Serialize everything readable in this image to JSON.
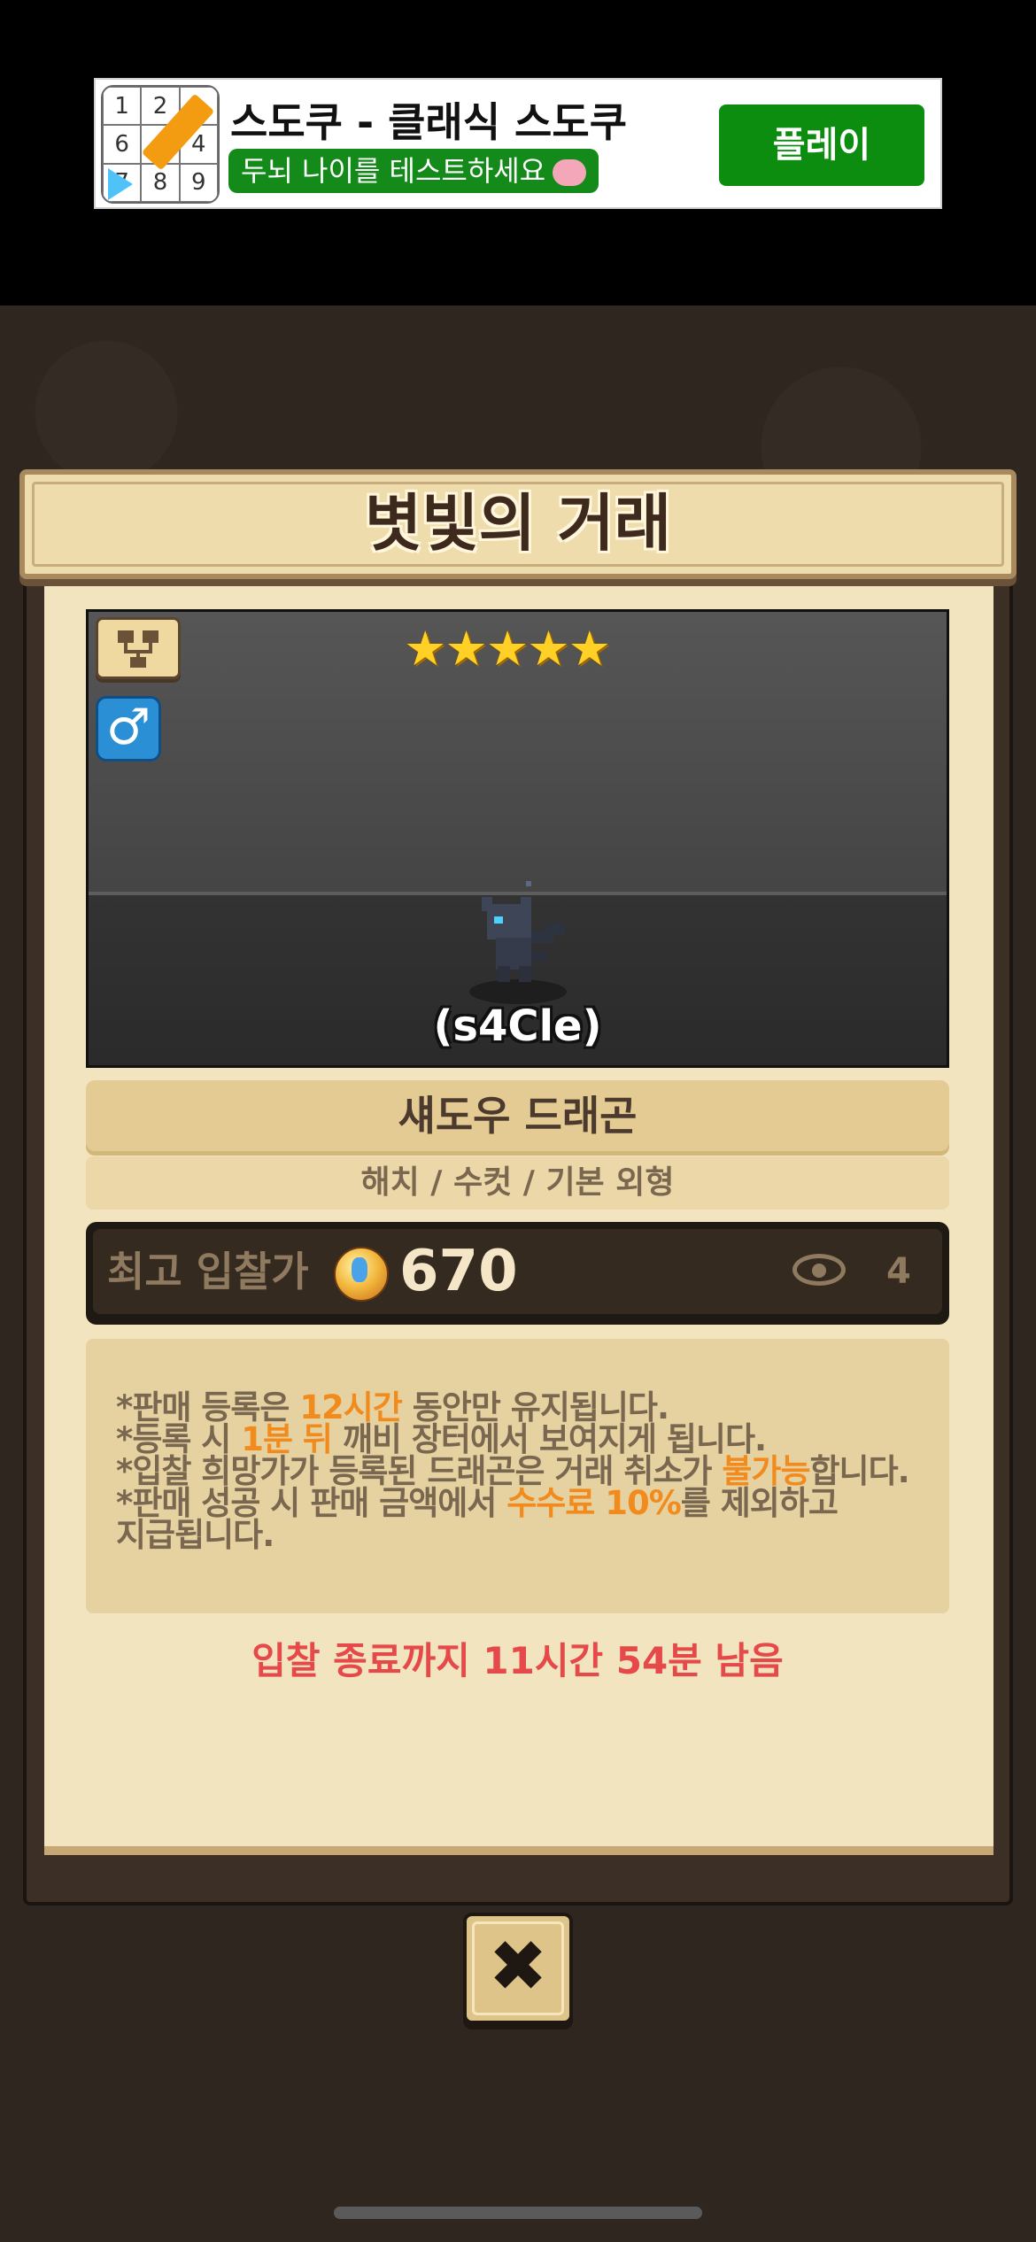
{
  "ad": {
    "title": "스도쿠 - 클래식 스도쿠",
    "subtitle": "두뇌 나이를 테스트하세요",
    "play_label": "플레이",
    "icon_digits": [
      "1",
      "2",
      "",
      "6",
      "",
      "4",
      "7",
      "8",
      "9"
    ]
  },
  "dialog": {
    "title": "볏빛의 거래",
    "stars": "★★★★★",
    "gender_symbol": "♂",
    "dragon_code": "(s4Cle)",
    "dragon_name": "섀도우 드래곤",
    "dragon_info": "해치 / 수컷 / 기본 외형",
    "bid_label": "최고 입찰가",
    "bid_value": "670",
    "view_count": "4",
    "notice": {
      "line1_a": "*판매 등록은 ",
      "line1_hl": "12시간",
      "line1_b": " 동안만 유지됩니다.",
      "line2_a": "*등록 시 ",
      "line2_hl": "1분 뒤",
      "line2_b": " 깨비 장터에서 보여지게 됩니다.",
      "line3_a": "*입찰 희망가가 등록된 드래곤은 거래 취소가 ",
      "line3_hl": "불가능",
      "line3_b": "합니다.",
      "line4_a": "*판매 성공 시 판매 금액에서 ",
      "line4_hl": "수수료 10%",
      "line4_b": "를 제외하고",
      "line5": "지급됩니다."
    },
    "timer_text": "입찰 종료까지 11시간 54분 남음",
    "close_symbol": "✖"
  },
  "colors": {
    "highlight": "#f28b1e",
    "timer": "#e5494a",
    "ad_green": "#0c8d10"
  }
}
